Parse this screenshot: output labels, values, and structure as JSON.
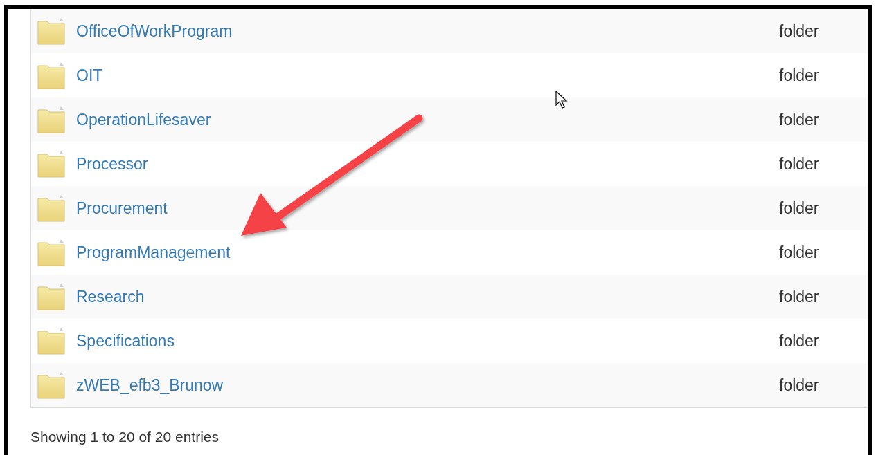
{
  "table": {
    "rows": [
      {
        "name": "OfficeOfWorkProgram",
        "type": "folder"
      },
      {
        "name": "OIT",
        "type": "folder"
      },
      {
        "name": "OperationLifesaver",
        "type": "folder"
      },
      {
        "name": "Processor",
        "type": "folder"
      },
      {
        "name": "Procurement",
        "type": "folder"
      },
      {
        "name": "ProgramManagement",
        "type": "folder"
      },
      {
        "name": "Research",
        "type": "folder"
      },
      {
        "name": "Specifications",
        "type": "folder"
      },
      {
        "name": "zWEB_efb3_Brunow",
        "type": "folder"
      }
    ]
  },
  "table_info": "Showing 1 to 20 of 20 entries"
}
